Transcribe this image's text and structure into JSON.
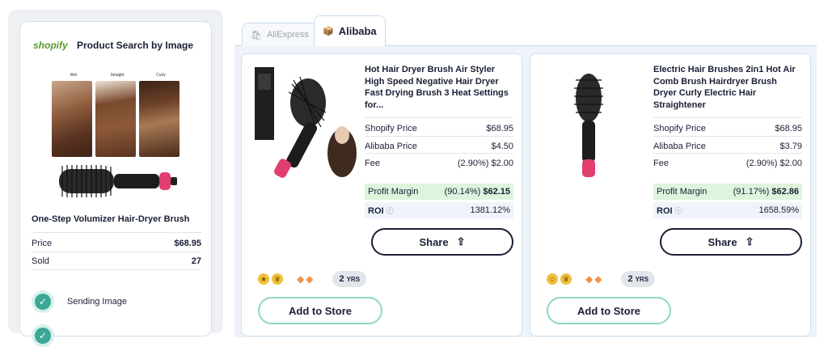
{
  "left": {
    "brand": "shopify",
    "title": "Product Search by Image",
    "image_labels": [
      "Wet",
      "Straight",
      "Curly"
    ],
    "product_name": "One-Step Volumizer Hair-Dryer Brush",
    "price_label": "Price",
    "price_value": "$68.95",
    "sold_label": "Sold",
    "sold_value": "27",
    "step_label": "Sending Image"
  },
  "tabs": [
    {
      "label": "AliExpress",
      "icon": "aliexpress-icon",
      "active": false
    },
    {
      "label": "Alibaba",
      "icon": "alibaba-box-icon",
      "active": true
    }
  ],
  "products": [
    {
      "title": "Hot Hair Dryer Brush Air Styler High Speed Negative Hair Dryer Fast Drying Brush 3 Heat Settings for...",
      "shopify_price_label": "Shopify Price",
      "shopify_price": "$68.95",
      "alibaba_price_label": "Alibaba Price",
      "alibaba_price": "$4.50",
      "fee_label": "Fee",
      "fee": "(2.90%) $2.00",
      "margin_label": "Profit Margin",
      "margin_pct": "(90.14%)",
      "margin_value": "$62.15",
      "roi_label": "ROI",
      "roi_value": "1381.12%",
      "share_label": "Share",
      "years": "2",
      "years_unit": "YRS",
      "add_label": "Add to Store"
    },
    {
      "title": "Electric Hair Brushes 2in1 Hot Air Comb Brush Hairdryer Brush Dryer Curly Electric Hair Straightener",
      "shopify_price_label": "Shopify Price",
      "shopify_price": "$68.95",
      "alibaba_price_label": "Alibaba Price",
      "alibaba_price": "$3.79",
      "fee_label": "Fee",
      "fee": "(2.90%) $2.00",
      "margin_label": "Profit Margin",
      "margin_pct": "(91.17%)",
      "margin_value": "$62.86",
      "roi_label": "ROI",
      "roi_value": "1658.59%",
      "share_label": "Share",
      "years": "2",
      "years_unit": "YRS",
      "add_label": "Add to Store"
    }
  ],
  "colors": {
    "accent": "#3aa894",
    "margin_bg": "#def4dd",
    "brand_green": "#5a9a2c"
  }
}
